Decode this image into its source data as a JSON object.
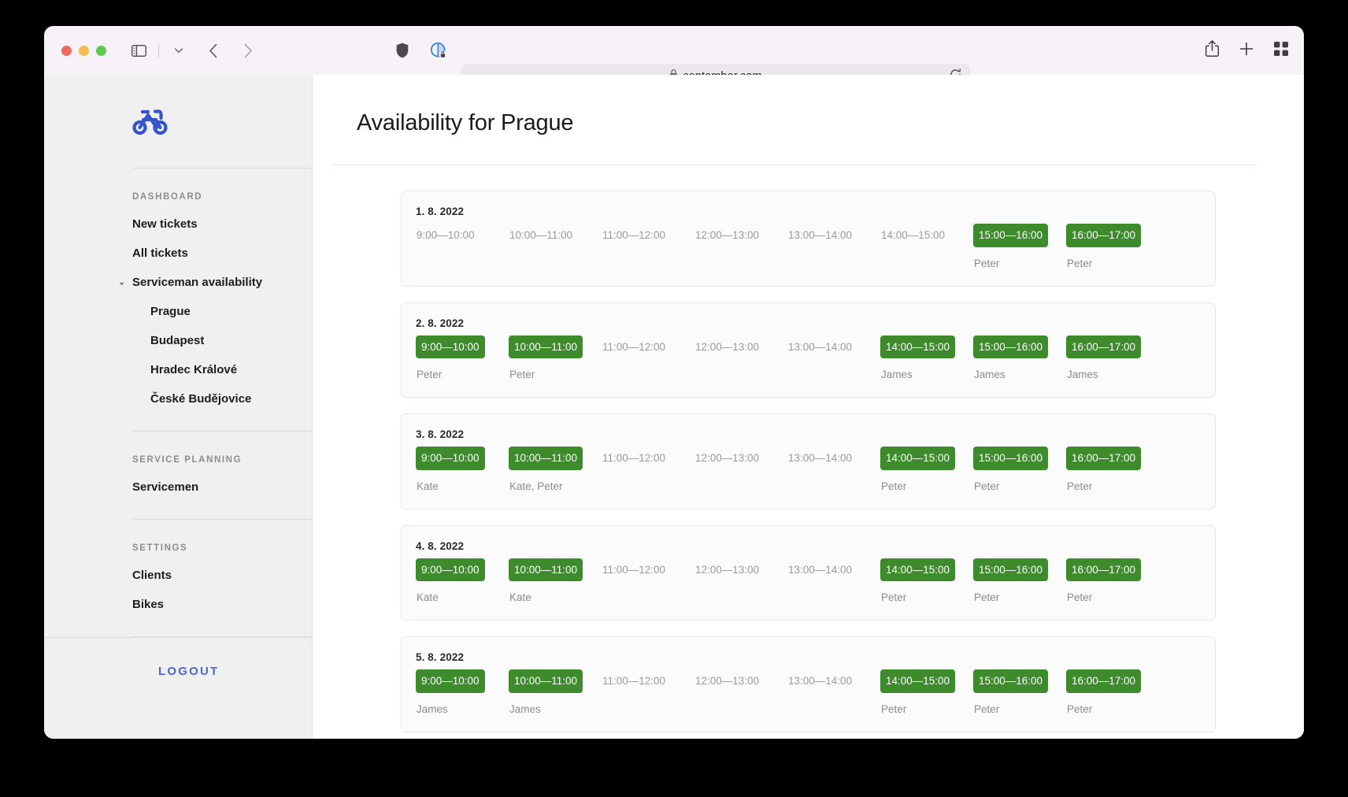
{
  "browser": {
    "url": "contember.com",
    "lock_icon": "lock-icon",
    "traffic_lights": [
      "close",
      "minimize",
      "zoom"
    ],
    "sidebar_toggle_icon": "sidebar-toggle-icon",
    "chevron_down_icon": "chevron-down-icon",
    "back_icon": "back-arrow-icon",
    "forward_icon": "forward-arrow-icon",
    "shield_icon": "privacy-shield-icon",
    "tracker_icon": "tracker-report-icon",
    "reload_icon": "reload-icon",
    "share_icon": "share-icon",
    "new_tab_icon": "plus-icon",
    "tab_overview_icon": "tab-overview-icon"
  },
  "sidebar": {
    "logo": "bicycle-logo",
    "logout_label": "LOGOUT",
    "sections": [
      {
        "label": "DASHBOARD",
        "items": [
          {
            "label": "New tickets",
            "sub": false,
            "caret": false
          },
          {
            "label": "All tickets",
            "sub": false,
            "caret": false
          },
          {
            "label": "Serviceman availability",
            "sub": false,
            "caret": true
          },
          {
            "label": "Prague",
            "sub": true,
            "caret": false
          },
          {
            "label": "Budapest",
            "sub": true,
            "caret": false
          },
          {
            "label": "Hradec Králové",
            "sub": true,
            "caret": false
          },
          {
            "label": "České Budějovice",
            "sub": true,
            "caret": false
          }
        ]
      },
      {
        "label": "SERVICE PLANNING",
        "items": [
          {
            "label": "Servicemen",
            "sub": false,
            "caret": false
          }
        ]
      },
      {
        "label": "SETTINGS",
        "items": [
          {
            "label": "Clients",
            "sub": false,
            "caret": false
          },
          {
            "label": "Bikes",
            "sub": false,
            "caret": false
          }
        ]
      }
    ]
  },
  "main": {
    "title": "Availability for Prague",
    "days": [
      {
        "date": "1. 8. 2022",
        "slots": [
          {
            "time": "9:00—10:00",
            "busy": false,
            "person": ""
          },
          {
            "time": "10:00—11:00",
            "busy": false,
            "person": ""
          },
          {
            "time": "11:00—12:00",
            "busy": false,
            "person": ""
          },
          {
            "time": "12:00—13:00",
            "busy": false,
            "person": ""
          },
          {
            "time": "13:00—14:00",
            "busy": false,
            "person": ""
          },
          {
            "time": "14:00—15:00",
            "busy": false,
            "person": ""
          },
          {
            "time": "15:00—16:00",
            "busy": true,
            "person": "Peter"
          },
          {
            "time": "16:00—17:00",
            "busy": true,
            "person": "Peter"
          }
        ]
      },
      {
        "date": "2. 8. 2022",
        "slots": [
          {
            "time": "9:00—10:00",
            "busy": true,
            "person": "Peter"
          },
          {
            "time": "10:00—11:00",
            "busy": true,
            "person": "Peter"
          },
          {
            "time": "11:00—12:00",
            "busy": false,
            "person": ""
          },
          {
            "time": "12:00—13:00",
            "busy": false,
            "person": ""
          },
          {
            "time": "13:00—14:00",
            "busy": false,
            "person": ""
          },
          {
            "time": "14:00—15:00",
            "busy": true,
            "person": "James"
          },
          {
            "time": "15:00—16:00",
            "busy": true,
            "person": "James"
          },
          {
            "time": "16:00—17:00",
            "busy": true,
            "person": "James"
          }
        ]
      },
      {
        "date": "3. 8. 2022",
        "slots": [
          {
            "time": "9:00—10:00",
            "busy": true,
            "person": "Kate"
          },
          {
            "time": "10:00—11:00",
            "busy": true,
            "person": "Kate, Peter"
          },
          {
            "time": "11:00—12:00",
            "busy": false,
            "person": ""
          },
          {
            "time": "12:00—13:00",
            "busy": false,
            "person": ""
          },
          {
            "time": "13:00—14:00",
            "busy": false,
            "person": ""
          },
          {
            "time": "14:00—15:00",
            "busy": true,
            "person": "Peter"
          },
          {
            "time": "15:00—16:00",
            "busy": true,
            "person": "Peter"
          },
          {
            "time": "16:00—17:00",
            "busy": true,
            "person": "Peter"
          }
        ]
      },
      {
        "date": "4. 8. 2022",
        "slots": [
          {
            "time": "9:00—10:00",
            "busy": true,
            "person": "Kate"
          },
          {
            "time": "10:00—11:00",
            "busy": true,
            "person": "Kate"
          },
          {
            "time": "11:00—12:00",
            "busy": false,
            "person": ""
          },
          {
            "time": "12:00—13:00",
            "busy": false,
            "person": ""
          },
          {
            "time": "13:00—14:00",
            "busy": false,
            "person": ""
          },
          {
            "time": "14:00—15:00",
            "busy": true,
            "person": "Peter"
          },
          {
            "time": "15:00—16:00",
            "busy": true,
            "person": "Peter"
          },
          {
            "time": "16:00—17:00",
            "busy": true,
            "person": "Peter"
          }
        ]
      },
      {
        "date": "5. 8. 2022",
        "slots": [
          {
            "time": "9:00—10:00",
            "busy": true,
            "person": "James"
          },
          {
            "time": "10:00—11:00",
            "busy": true,
            "person": "James"
          },
          {
            "time": "11:00—12:00",
            "busy": false,
            "person": ""
          },
          {
            "time": "12:00—13:00",
            "busy": false,
            "person": ""
          },
          {
            "time": "13:00—14:00",
            "busy": false,
            "person": ""
          },
          {
            "time": "14:00—15:00",
            "busy": true,
            "person": "Peter"
          },
          {
            "time": "15:00—16:00",
            "busy": true,
            "person": "Peter"
          },
          {
            "time": "16:00—17:00",
            "busy": true,
            "person": "Peter"
          }
        ]
      }
    ]
  },
  "colors": {
    "accent_blue": "#4a66d8",
    "busy_green": "#3d8b2d",
    "sidebar_bg": "#f0f0f0",
    "card_bg": "#fbfbfb"
  }
}
